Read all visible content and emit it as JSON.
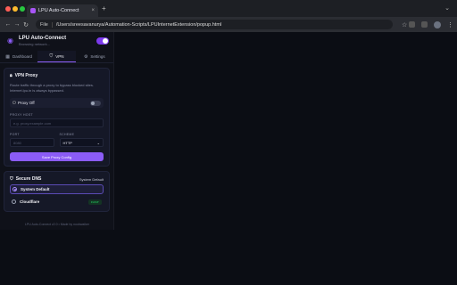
{
  "browser": {
    "tab_title": "LPU Auto-Connect",
    "tab_close": "×",
    "new_tab": "+",
    "tabbar_menu": "⌄",
    "back": "←",
    "forward": "→",
    "reload": "↻",
    "scheme_label": "File",
    "url": "/Users/sreesavanurya/Automation-Scripts/LPUInternetExtension/popup.html",
    "star": "☆"
  },
  "popup": {
    "title": "LPU Auto-Connect",
    "subtitle": "Browsing network...",
    "master_toggle_on": true,
    "tabs": [
      {
        "label": "Dashboard",
        "icon": "grid-icon",
        "glyph": "▦",
        "active": false
      },
      {
        "label": "VPN",
        "icon": "shield-icon",
        "glyph": "⛉",
        "active": true
      },
      {
        "label": "Settings",
        "icon": "gear-icon",
        "glyph": "⚙",
        "active": false
      }
    ],
    "vpn": {
      "title": "VPN Proxy",
      "icon": "lock-icon",
      "description": "Route traffic through a proxy to bypass blocked sites. Internet.lpu.in is always bypassed.",
      "proxy_label": "Proxy Off",
      "proxy_on": false,
      "host_label": "PROXY HOST",
      "host_placeholder": "e.g. proxy.example.com",
      "port_label": "PORT",
      "port_placeholder": "8080",
      "scheme_label": "SCHEME",
      "scheme_value": "HTTP",
      "save_label": "Save Proxy Config"
    },
    "dns": {
      "title": "Secure DNS",
      "icon": "shield-icon",
      "current": "System Default",
      "options": [
        {
          "label": "System Default",
          "selected": true,
          "badge": ""
        },
        {
          "label": "Cloudflare",
          "selected": false,
          "badge": "FAST"
        }
      ]
    },
    "footer": "LPU Auto-Connect v2.0  •  Made by noobwalker"
  },
  "colors": {
    "accent": "#8b5cf6",
    "background": "#0b0d14",
    "badge_green": "#22c55e"
  }
}
